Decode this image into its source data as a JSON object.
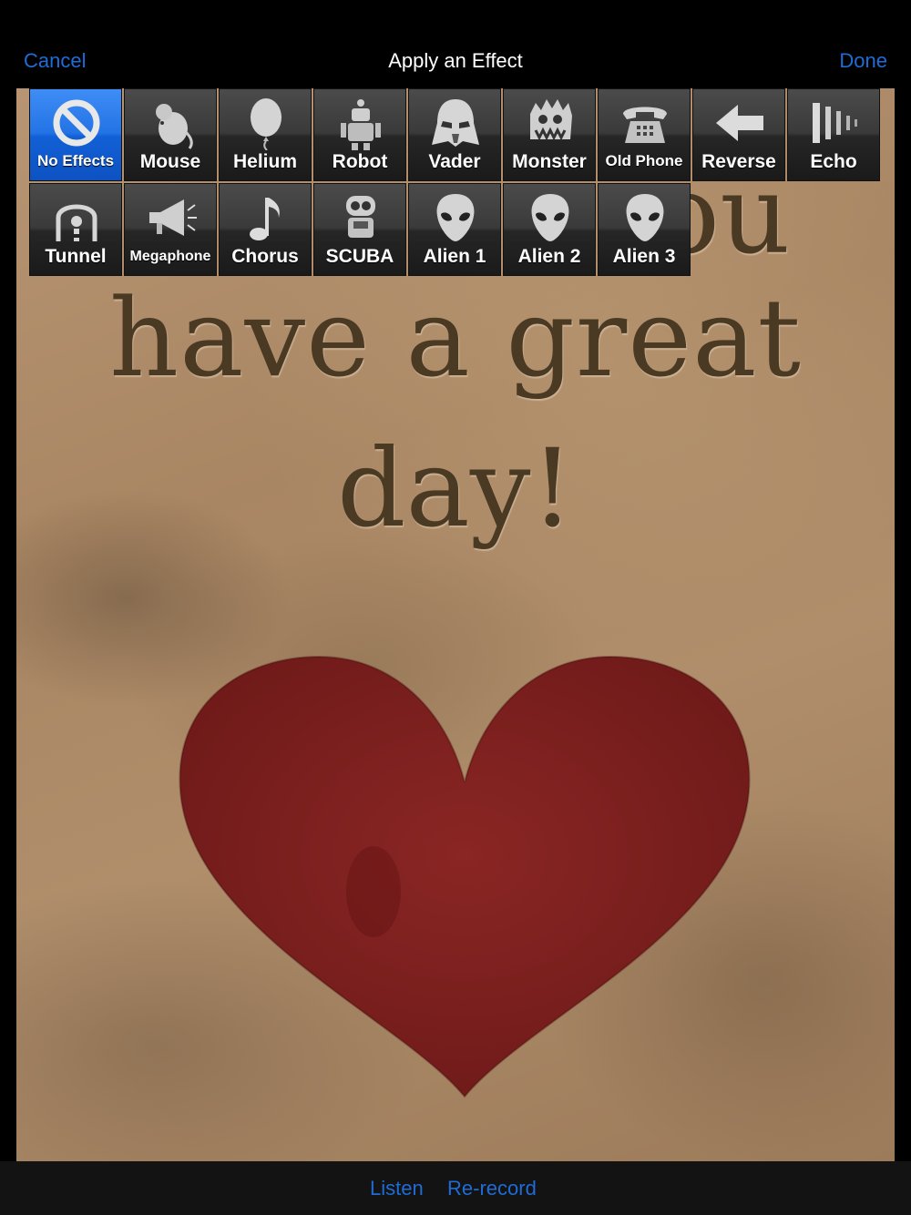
{
  "navbar": {
    "cancel": "Cancel",
    "title": "Apply an Effect",
    "done": "Done"
  },
  "card": {
    "partial_word": "ou",
    "line1": "have a great",
    "line2": "day!"
  },
  "effects": [
    {
      "label": "No Effects",
      "icon": "no-symbol-icon",
      "selected": true
    },
    {
      "label": "Mouse",
      "icon": "mouse-icon"
    },
    {
      "label": "Helium",
      "icon": "balloon-icon"
    },
    {
      "label": "Robot",
      "icon": "robot-icon"
    },
    {
      "label": "Vader",
      "icon": "vader-helmet-icon"
    },
    {
      "label": "Monster",
      "icon": "monster-icon"
    },
    {
      "label": "Old Phone",
      "icon": "telephone-icon"
    },
    {
      "label": "Reverse",
      "icon": "arrow-left-icon"
    },
    {
      "label": "Echo",
      "icon": "echo-bars-icon"
    },
    {
      "label": "Tunnel",
      "icon": "tunnel-icon"
    },
    {
      "label": "Megaphone",
      "icon": "megaphone-icon"
    },
    {
      "label": "Chorus",
      "icon": "music-note-icon"
    },
    {
      "label": "SCUBA",
      "icon": "scuba-icon"
    },
    {
      "label": "Alien 1",
      "icon": "alien-icon"
    },
    {
      "label": "Alien 2",
      "icon": "alien-icon"
    },
    {
      "label": "Alien 3",
      "icon": "alien-icon"
    }
  ],
  "bottombar": {
    "listen": "Listen",
    "rerecord": "Re-record"
  },
  "colors": {
    "accent": "#1f6cd6",
    "selected": "#2373e6",
    "heart": "#7a1e1c"
  }
}
